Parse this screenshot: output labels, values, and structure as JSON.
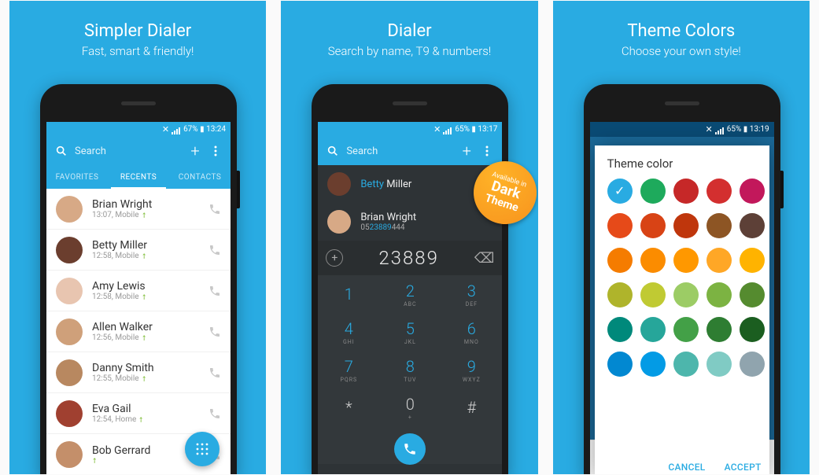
{
  "panels": [
    {
      "title": "Simpler Dialer",
      "subtitle": "Fast, smart & friendly!"
    },
    {
      "title": "Dialer",
      "subtitle": "Search by name, T9 & numbers!"
    },
    {
      "title": "Theme Colors",
      "subtitle": "Choose your own style!"
    }
  ],
  "status_text": {
    "p1": "67% ▮ 13:24",
    "p2": "65% ▮ 13:17",
    "p3": "65% ▮ 13:19"
  },
  "search_placeholder": "Search",
  "tabs": [
    "FAVORITES",
    "RECENTS",
    "CONTACTS"
  ],
  "contacts": [
    {
      "name": "Brian Wright",
      "meta": "13:07, Mobile",
      "av": "#d7a986"
    },
    {
      "name": "Betty Miller",
      "meta": "12:58, Mobile",
      "av": "#6b3e2e"
    },
    {
      "name": "Amy Lewis",
      "meta": "12:58, Mobile",
      "av": "#e8c5b0"
    },
    {
      "name": "Allen Walker",
      "meta": "12:56, Mobile",
      "av": "#cfa07a"
    },
    {
      "name": "Danny Smith",
      "meta": "12:55, Mobile",
      "av": "#b88860"
    },
    {
      "name": "Eva Gail",
      "meta": "12:54, Home",
      "av": "#a04030"
    },
    {
      "name": "Bob Gerrard",
      "meta": "",
      "av": "#c48f6a"
    }
  ],
  "dark_results": [
    {
      "pre": "",
      "match": "Betty",
      "post": " Miller",
      "sub": "",
      "av": "#6b3e2e"
    },
    {
      "pre": "Brian Wright",
      "match": "",
      "post": "",
      "sub_pre": "05",
      "sub_match": "23889",
      "sub_post": "444",
      "av": "#d7a986"
    }
  ],
  "dial_number": "23889",
  "keypad": [
    {
      "n": "1",
      "l": ""
    },
    {
      "n": "2",
      "l": "ABC"
    },
    {
      "n": "3",
      "l": "DEF"
    },
    {
      "n": "4",
      "l": "GHI"
    },
    {
      "n": "5",
      "l": "JKL"
    },
    {
      "n": "6",
      "l": "MNO"
    },
    {
      "n": "7",
      "l": "PQRS"
    },
    {
      "n": "8",
      "l": "TUV"
    },
    {
      "n": "9",
      "l": "WXYZ"
    },
    {
      "n": "*",
      "l": ""
    },
    {
      "n": "0",
      "l": "+"
    },
    {
      "n": "#",
      "l": ""
    }
  ],
  "badge": {
    "l1": "Available in",
    "l2": "Dark",
    "l3": "Theme"
  },
  "theme": {
    "title": "Theme color",
    "behind_contact": "Bob Gerrard",
    "colors": [
      "#29abe2",
      "#1eaa5c",
      "#c62828",
      "#d32f2f",
      "#c2185b",
      "#e64a19",
      "#d84315",
      "#bf360c",
      "#8d5524",
      "#5d4037",
      "#f57c00",
      "#fb8c00",
      "#ff9800",
      "#ffa726",
      "#ffb300",
      "#afb42b",
      "#c0ca33",
      "#9ccc65",
      "#7cb342",
      "#558b2f",
      "#00897b",
      "#26a69a",
      "#43a047",
      "#2e7d32",
      "#1b5e20",
      "#0288d1",
      "#039be5",
      "#4db6ac",
      "#80cbc4",
      "#90a4ae"
    ],
    "selected": 0,
    "cancel": "CANCEL",
    "accept": "ACCEPT"
  }
}
